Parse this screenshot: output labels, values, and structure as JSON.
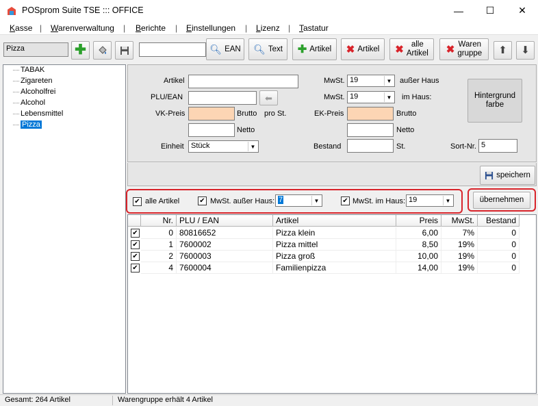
{
  "window": {
    "title": "POSprom Suite TSE ::: OFFICE",
    "minimize": "—",
    "maximize": "☐",
    "close": "✕"
  },
  "menu": [
    {
      "key": "K",
      "rest": "asse"
    },
    {
      "key": "W",
      "rest": "arenverwaltung"
    },
    {
      "key": "B",
      "rest": "erichte"
    },
    {
      "key": "E",
      "rest": "instellungen"
    },
    {
      "key": "L",
      "rest": "izenz"
    },
    {
      "key": "T",
      "rest": "astatur"
    }
  ],
  "toolbar": {
    "group_value": "Pizza",
    "search_value": "",
    "ean": "EAN",
    "text": "Text",
    "add_article": "Artikel",
    "delete_article": "Artikel",
    "all_articles": "alle\nArtikel",
    "delete_group": "Waren\ngruppe"
  },
  "tree": {
    "items": [
      "TABAK",
      "Zigareten",
      "Alcoholfrei",
      "Alcohol",
      "Lebensmittel",
      "Pizza"
    ],
    "selected": 5
  },
  "form": {
    "artikel_label": "Artikel",
    "artikel_value": "",
    "plu_label": "PLU/EAN",
    "plu_value": "",
    "vk_label": "VK-Preis",
    "vk_value": "",
    "brutto1": "Brutto",
    "pro_st": "pro St.",
    "netto1": "Netto",
    "vk_netto_value": "",
    "einheit_label": "Einheit",
    "einheit_value": "Stück",
    "mwst_label1": "MwSt.",
    "mwst_value1": "19",
    "ausser_haus": "außer Haus",
    "mwst_label2": "MwSt.",
    "mwst_value2": "19",
    "im_haus": "im Haus:",
    "ek_label": "EK-Preis",
    "ek_value": "",
    "brutto2": "Brutto",
    "netto2": "Netto",
    "ek_netto_value": "",
    "bestand_label": "Bestand",
    "bestand_value": "",
    "st": "St.",
    "sort_label": "Sort-Nr.",
    "sort_value": "5",
    "hintergrund": "Hintergrund\nfarbe"
  },
  "save_button": "speichern",
  "filter": {
    "all_articles": "alle Artikel",
    "mwst_ausser": "MwSt. außer Haus:",
    "mwst_ausser_value": "7",
    "mwst_im": "MwSt. im Haus:",
    "mwst_im_value": "19",
    "apply": "übernehmen"
  },
  "grid": {
    "columns": [
      "Nr.",
      "PLU / EAN",
      "Artikel",
      "Preis",
      "MwSt.",
      "Bestand"
    ],
    "rows": [
      {
        "nr": "0",
        "plu": "80816652",
        "artikel": "Pizza klein",
        "preis": "6,00",
        "mwst": "7%",
        "bestand": "0"
      },
      {
        "nr": "1",
        "plu": "7600002",
        "artikel": "Pizza mittel",
        "preis": "8,50",
        "mwst": "19%",
        "bestand": "0"
      },
      {
        "nr": "2",
        "plu": "7600003",
        "artikel": "Pizza groß",
        "preis": "10,00",
        "mwst": "19%",
        "bestand": "0"
      },
      {
        "nr": "4",
        "plu": "7600004",
        "artikel": "Familienpizza",
        "preis": "14,00",
        "mwst": "19%",
        "bestand": "0"
      }
    ]
  },
  "status": {
    "left": "Gesamt: 264 Artikel",
    "right": "Warengruppe erhält 4 Artikel"
  },
  "colors": {
    "accent": "#0078d7",
    "highlight": "#d8232a",
    "peach": "#fcd5b4"
  }
}
